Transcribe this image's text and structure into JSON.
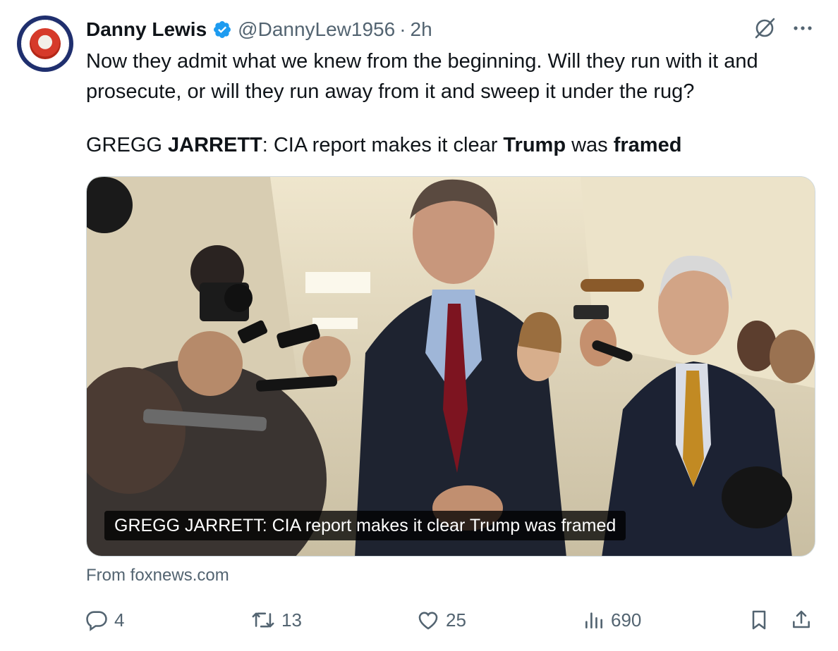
{
  "tweet": {
    "author_name": "Danny Lewis",
    "handle": "@DannyLew1956",
    "separator": "·",
    "time": "2h",
    "text_line_1": "Now they admit what we knew from the beginning. Will they run with it and prosecute, or will they run away from it and sweep it under the rug?",
    "headline": {
      "part1": "GREGG ",
      "bold1": "JARRETT",
      "part2": ": CIA report makes it clear ",
      "bold2": "Trump",
      "part3": " was ",
      "bold3": "framed"
    }
  },
  "media": {
    "caption": "GREGG JARRETT: CIA report makes it clear Trump was framed",
    "source": "From foxnews.com"
  },
  "actions": {
    "replies": "4",
    "reposts": "13",
    "likes": "25",
    "views": "690"
  },
  "icons": {
    "verified": "verified-badge-icon",
    "grok": "grok-icon",
    "more": "more-icon",
    "reply": "reply-icon",
    "repost": "repost-icon",
    "like": "like-icon",
    "views": "views-icon",
    "bookmark": "bookmark-icon",
    "share": "share-icon"
  },
  "colors": {
    "verified_blue": "#1d9bf0",
    "secondary_text": "#536471",
    "primary_text": "#0f1419"
  }
}
